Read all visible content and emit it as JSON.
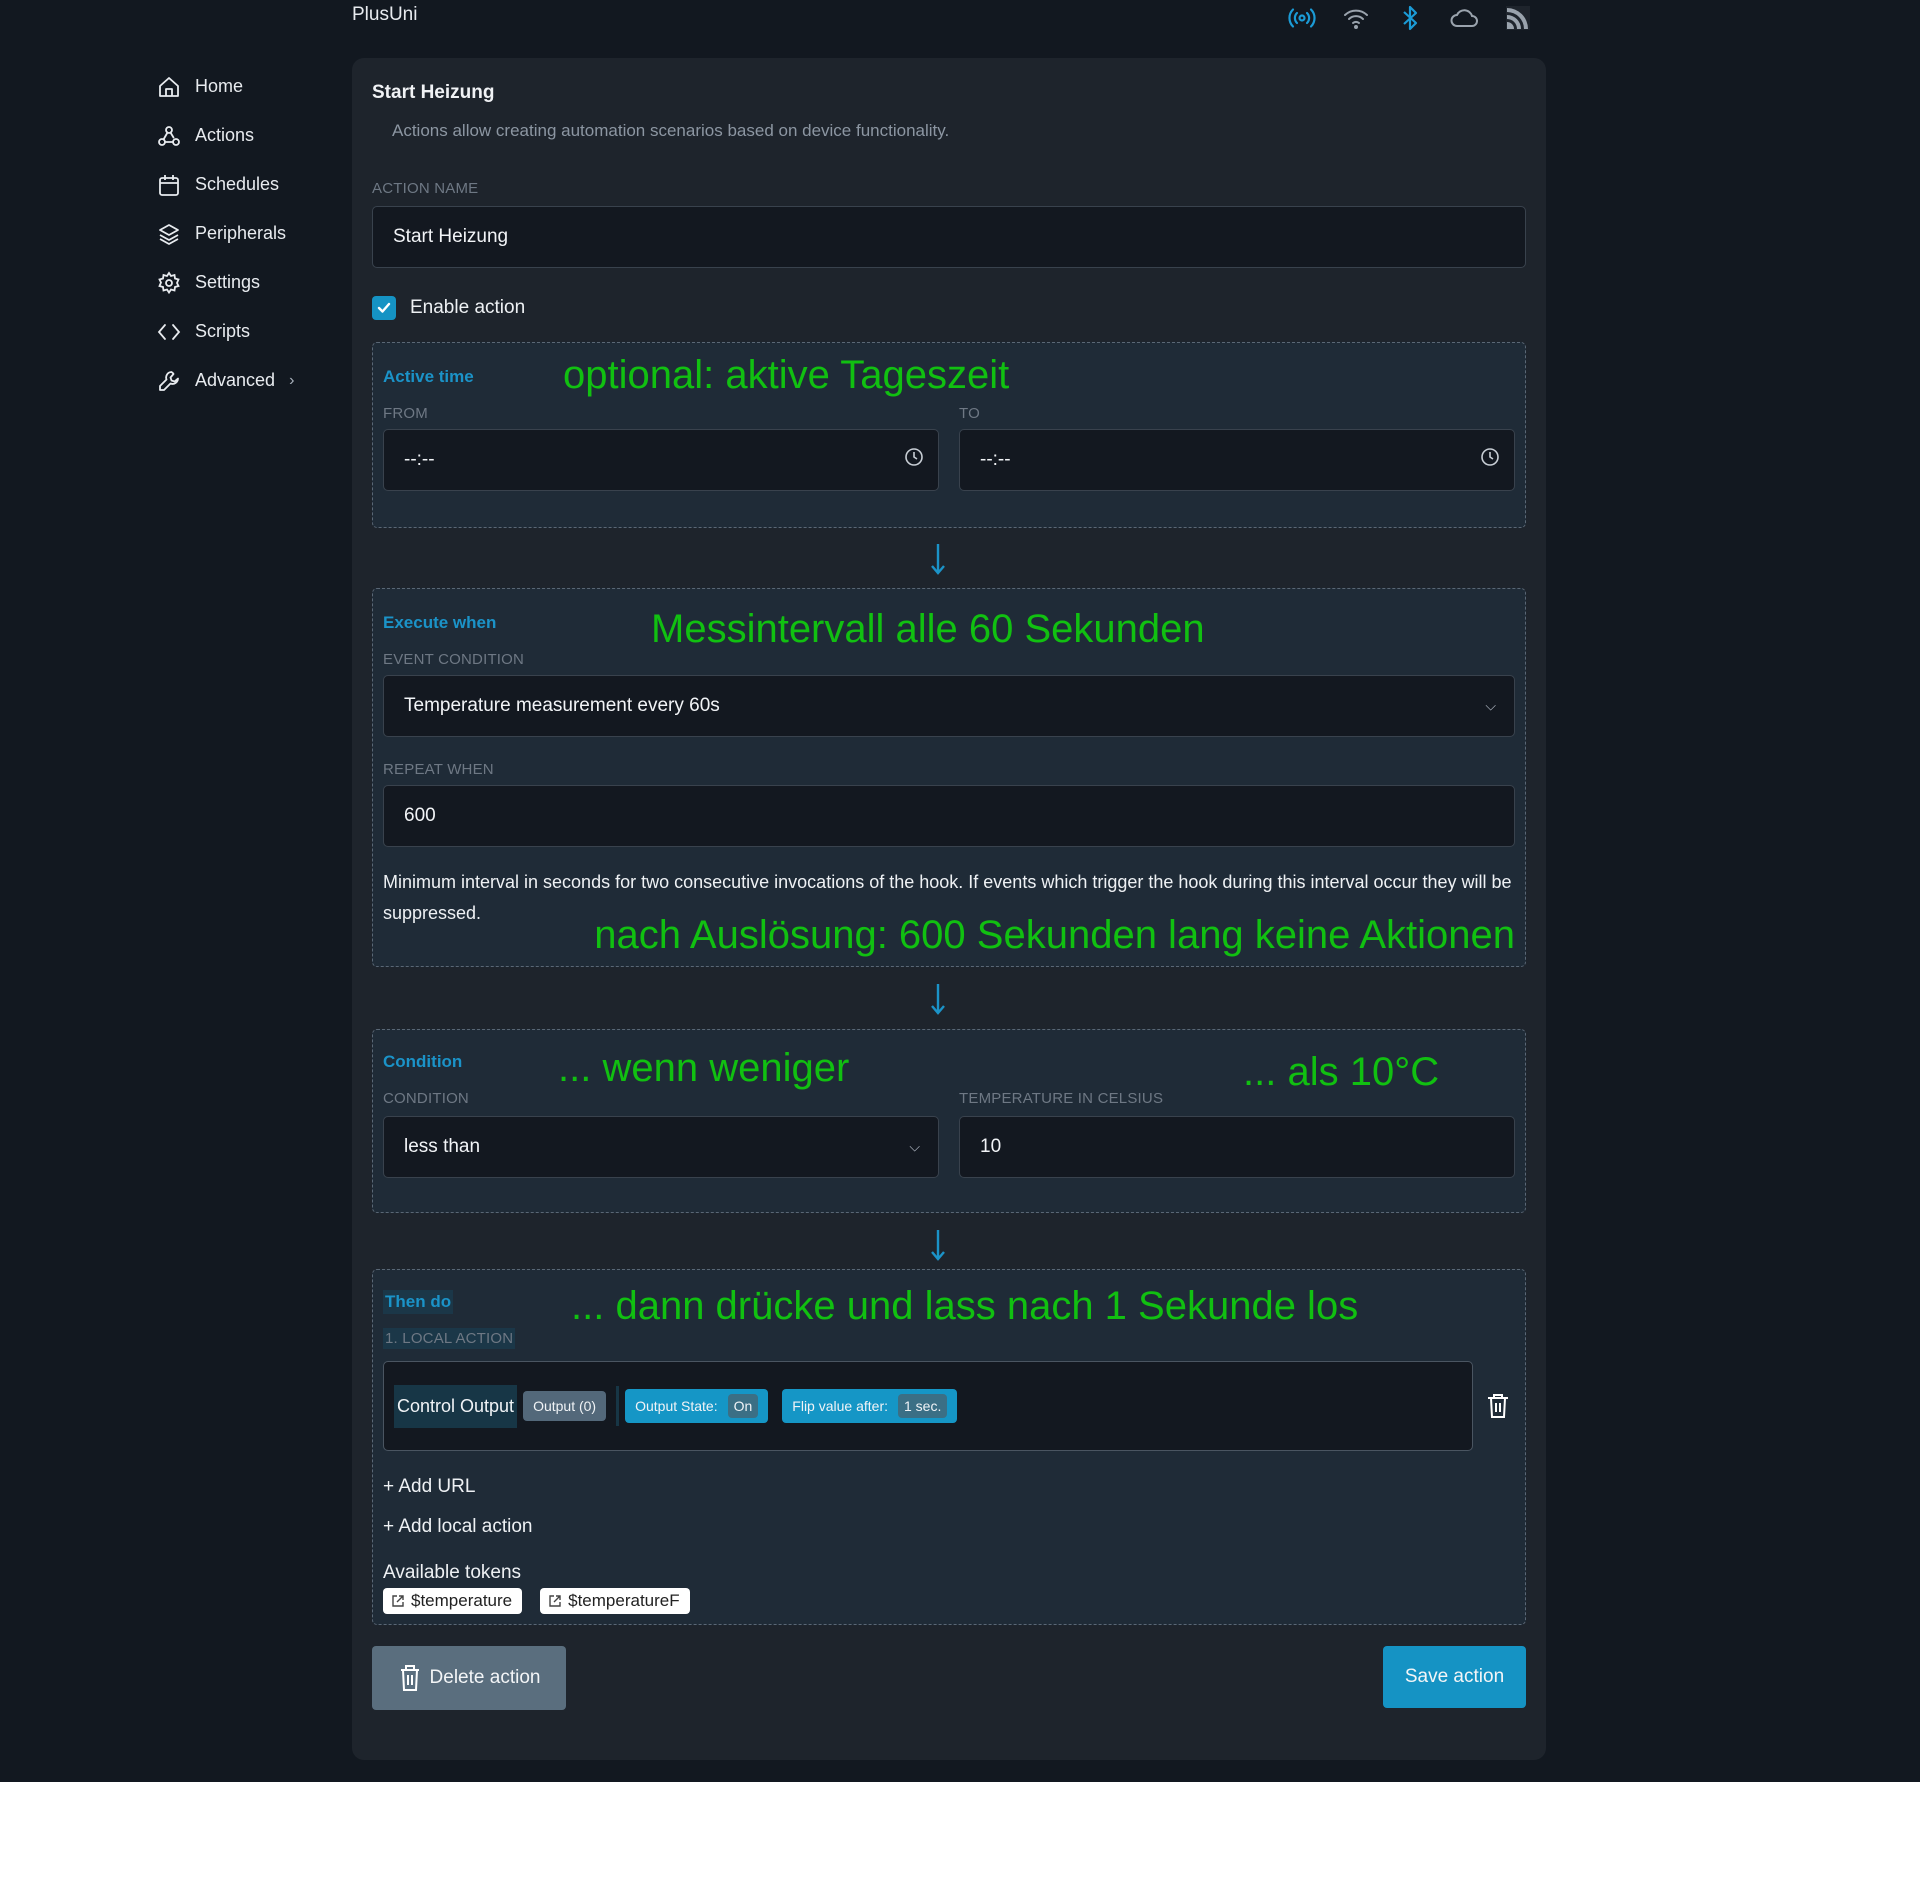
{
  "app": {
    "title": "PlusUni",
    "status_icons": [
      {
        "name": "broadcast-icon",
        "color": "#1b9bd6"
      },
      {
        "name": "wifi-icon",
        "color": "#9aa3ad"
      },
      {
        "name": "bluetooth-icon",
        "color": "#1b9bd6"
      },
      {
        "name": "cloud-icon",
        "color": "#9aa3ad"
      },
      {
        "name": "rss-icon",
        "color": "#9aa3ad"
      }
    ]
  },
  "sidebar": {
    "items": [
      {
        "label": "Home",
        "icon": "home-icon"
      },
      {
        "label": "Actions",
        "icon": "webhook-icon"
      },
      {
        "label": "Schedules",
        "icon": "calendar-icon"
      },
      {
        "label": "Peripherals",
        "icon": "layers-icon"
      },
      {
        "label": "Settings",
        "icon": "gear-icon"
      },
      {
        "label": "Scripts",
        "icon": "code-icon"
      },
      {
        "label": "Advanced",
        "icon": "wrench-icon",
        "has_submenu": true
      }
    ]
  },
  "form": {
    "title": "Start Heizung",
    "subtitle": "Actions allow creating automation scenarios based on device functionality.",
    "action_name_label": "ACTION NAME",
    "action_name_value": "Start Heizung",
    "enable_label": "Enable action",
    "enabled": true,
    "active_time": {
      "title": "Active time",
      "annotation": "optional: aktive Tageszeit",
      "from_label": "FROM",
      "from_value": "--:--",
      "to_label": "TO",
      "to_value": "--:--"
    },
    "execute_when": {
      "title": "Execute when",
      "annotation": "Messintervall alle 60 Sekunden",
      "event_condition_label": "EVENT CONDITION",
      "event_condition_value": "Temperature measurement every 60s",
      "repeat_when_label": "REPEAT WHEN",
      "repeat_when_value": "600",
      "help_text": "Minimum interval in seconds for two consecutive invocations of the hook. If events which trigger the hook during this interval occur they will be suppressed.",
      "annotation2": "nach Auslösung: 600 Sekunden lang keine Aktionen"
    },
    "condition": {
      "title": "Condition",
      "annotation_left": "... wenn weniger",
      "annotation_right": "... als 10°C",
      "condition_label": "CONDITION",
      "condition_value": "less than",
      "temperature_label": "TEMPERATURE IN CELSIUS",
      "temperature_value": "10"
    },
    "then_do": {
      "title": "Then do",
      "annotation": "... dann drücke und lass nach 1 Sekunde los",
      "local_action_label": "1. LOCAL ACTION",
      "action_name": "Control Output",
      "output_chip": "Output (0)",
      "state_label": "Output State:",
      "state_value": "On",
      "flip_label": "Flip value after:",
      "flip_value": "1 sec.",
      "add_url": "+ Add URL",
      "add_local_action": "+ Add local action",
      "tokens_label": "Available tokens",
      "tokens": [
        "$temperature",
        "$temperatureF"
      ]
    },
    "delete_label": "Delete action",
    "save_label": "Save action"
  },
  "colors": {
    "accent": "#1593c4",
    "annotation": "#11c011",
    "background": "#121820",
    "card": "#1e242c"
  }
}
